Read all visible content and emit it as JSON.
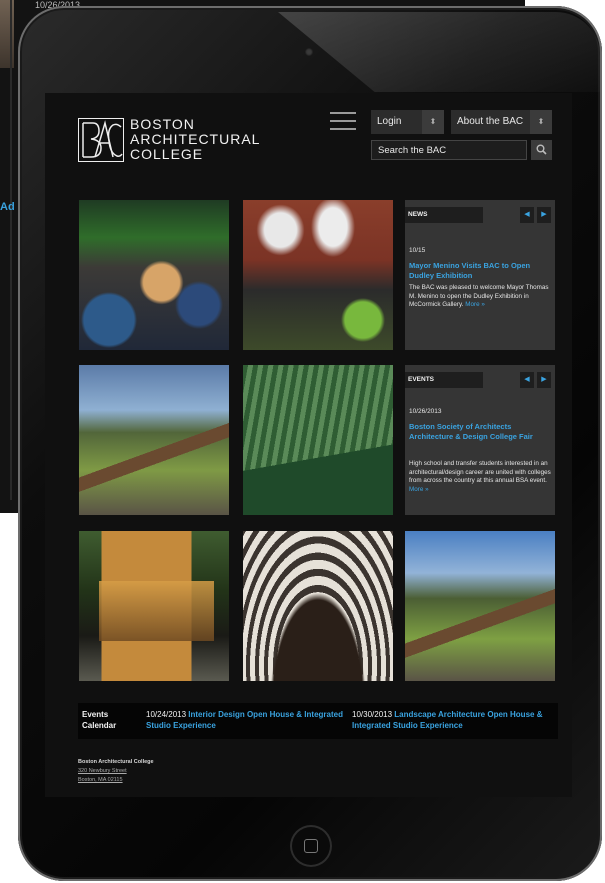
{
  "background_device": {
    "date": "10/26/2013",
    "link_fragment": "Ad"
  },
  "header": {
    "logo_lines": [
      "BOSTON",
      "ARCHITECTURAL",
      "COLLEGE"
    ],
    "login_label": "Login",
    "about_label": "About the BAC",
    "search_placeholder": "Search the BAC"
  },
  "news": {
    "title": "NEWS",
    "date": "10/15",
    "headline": "Mayor Menino Visits BAC to Open Dudley Exhibition",
    "body": "The BAC was pleased to welcome Mayor Thomas M. Menino to open the Dudley Exhibition in McCormick Gallery.",
    "more": "More »"
  },
  "events": {
    "title": "EVENTS",
    "date": "10/26/2013",
    "headline": "Boston Society of Architects Architecture & Design College Fair",
    "body": "High school and transfer students interested in an architectural/design career are united with colleges from across the country at this annual BSA event.",
    "more": "More »"
  },
  "calendar": {
    "label_line1": "Events",
    "label_line2": "Calendar",
    "items": [
      {
        "date": "10/24/2013",
        "title": "Interior Design Open House & Integrated Studio Experience"
      },
      {
        "date": "10/30/2013",
        "title": "Landscape Architecture Open House & Integrated Studio Experience"
      }
    ]
  },
  "footer": {
    "name": "Boston Architectural College",
    "address1": "320 Newbury Street",
    "address2": "Boston, MA 02115"
  },
  "icons": {
    "menu": "hamburger-menu-icon",
    "search": "magnifier-icon",
    "prev": "chevron-left-icon",
    "next": "chevron-right-icon",
    "dropdown": "up-down-arrows-icon"
  },
  "colors": {
    "accent": "#3aa3e0",
    "screen_bg": "#101010",
    "panel_bg": "#353535"
  }
}
